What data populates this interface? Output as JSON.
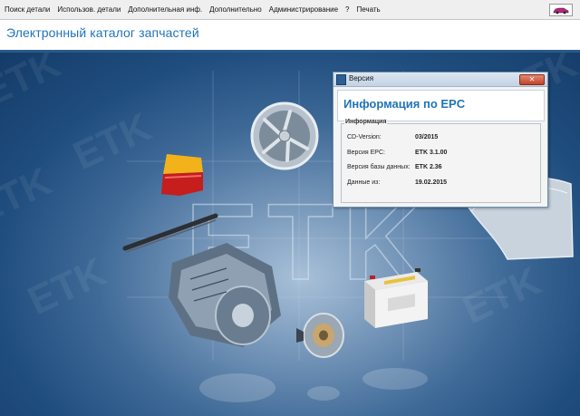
{
  "menu": {
    "items": [
      "Поиск детали",
      "Использов. детали",
      "Дополнительная инф.",
      "Дополнительно",
      "Администрирование",
      "?",
      "Печать"
    ]
  },
  "header": {
    "title": "Электронный каталог запчастей"
  },
  "dialog": {
    "window_title": "Версия",
    "heading": "Информация по EPC",
    "group_label": "Информация",
    "rows": [
      {
        "label": "CD-Version:",
        "value": "03/2015"
      },
      {
        "label": "Версия EPC:",
        "value": "ETK 3.1.00"
      },
      {
        "label": "Версия базы данных:",
        "value": "ETK 2.36"
      },
      {
        "label": "Данные из:",
        "value": "19.02.2015"
      }
    ]
  },
  "background": {
    "watermark_text": "ETK",
    "logo_text": "ETK",
    "parts": [
      "brake-disc",
      "tail-light",
      "wiper-blade",
      "transmission",
      "alloy-wheel",
      "battery",
      "fender"
    ]
  },
  "colors": {
    "title_blue": "#1f74b8",
    "header_border": "#2a5a88",
    "background_dark": "#143b68"
  }
}
